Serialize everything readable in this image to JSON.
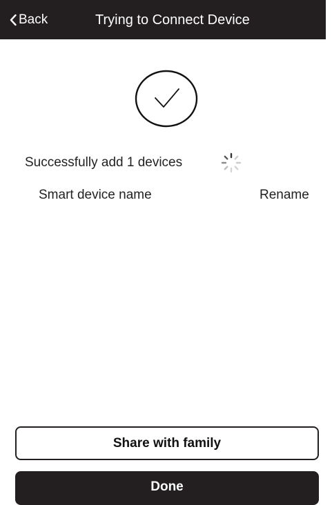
{
  "header": {
    "back_label": "Back",
    "title": "Trying to Connect Device",
    "background_color": "#231f20"
  },
  "status": {
    "icon": "checkmark-circle-icon",
    "message": "Successfully add 1 devices",
    "loading_icon": "spinner-icon"
  },
  "device": {
    "name_label": "Smart device name",
    "rename_label": "Rename"
  },
  "actions": {
    "share_label": "Share with family",
    "done_label": "Done"
  }
}
